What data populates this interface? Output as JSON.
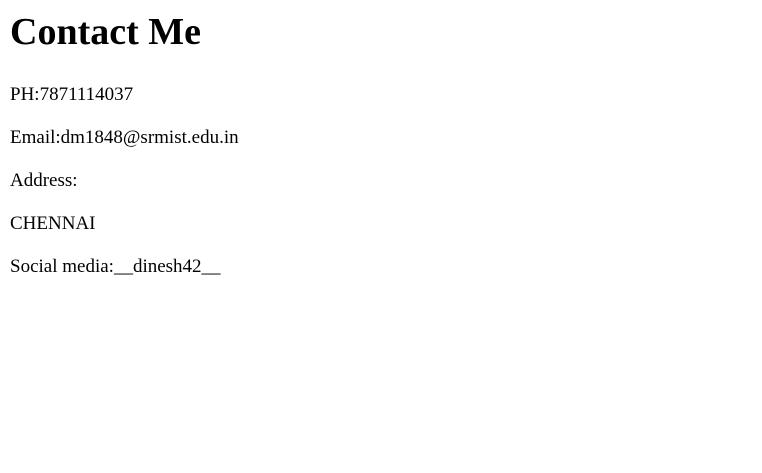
{
  "page": {
    "title": "Contact Me"
  },
  "contact": {
    "phone": "PH:7871114037",
    "email": "Email:dm1848@srmist.edu.in",
    "address_label": "Address:",
    "address_value": "CHENNAI",
    "social": "Social media:__dinesh42__"
  }
}
